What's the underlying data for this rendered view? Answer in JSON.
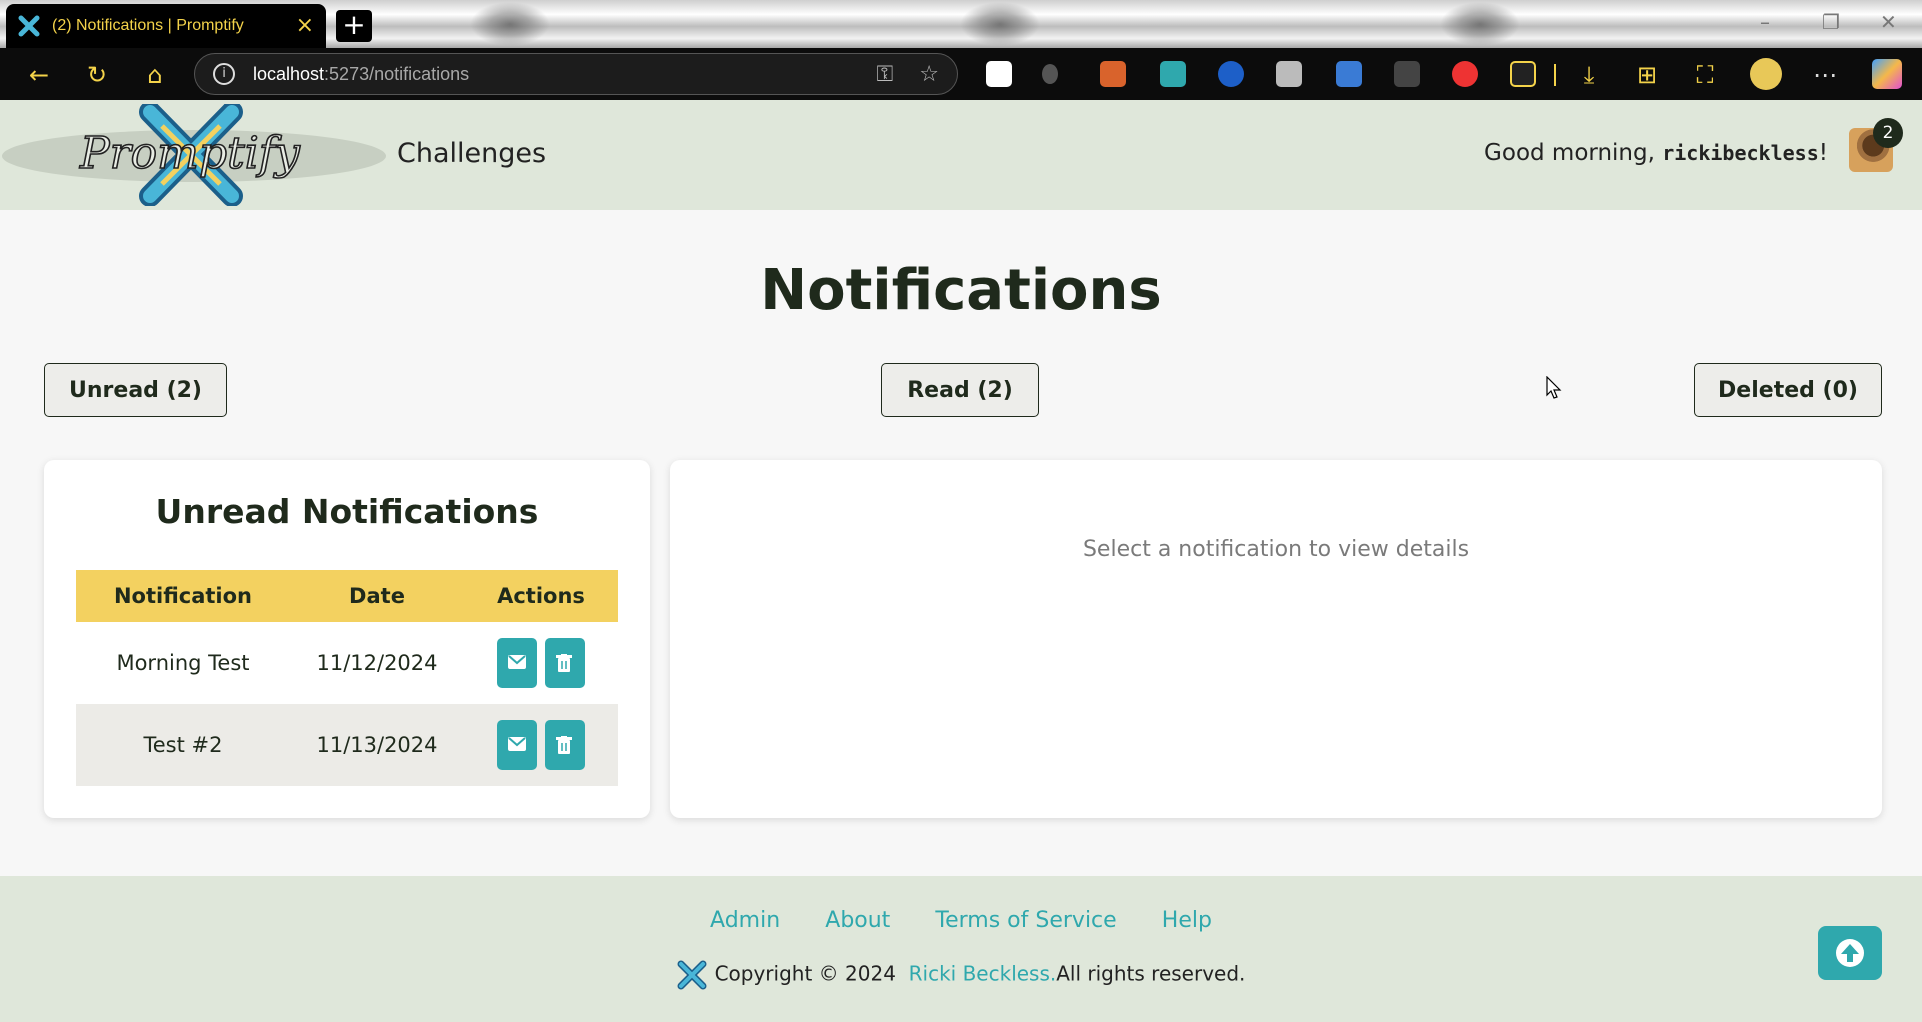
{
  "browser": {
    "tab_title": "(2) Notifications | Promptify",
    "tab_close": "×",
    "new_tab": "+",
    "url_host": "localhost",
    "url_path": ":5273/notifications",
    "icons": [
      "back-icon",
      "refresh-icon",
      "home-icon",
      "info-icon",
      "key-icon",
      "star-icon",
      "extensions",
      "download-icon",
      "collections-icon",
      "more-icon",
      "copilot-icon"
    ]
  },
  "header": {
    "brand": "Promptify",
    "nav_challenges": "Challenges",
    "greeting_prefix": "Good morning, ",
    "username": "rickibeckless",
    "greeting_suffix": "!",
    "notification_count": "2"
  },
  "page": {
    "title": "Notifications",
    "filters": [
      {
        "label": "Unread (2)"
      },
      {
        "label": "Read (2)"
      },
      {
        "label": "Deleted (0)"
      }
    ]
  },
  "list": {
    "title": "Unread Notifications",
    "columns": [
      "Notification",
      "Date",
      "Actions"
    ],
    "rows": [
      {
        "notification": "Morning Test",
        "date": "11/12/2024"
      },
      {
        "notification": "Test #2",
        "date": "11/13/2024"
      }
    ]
  },
  "detail": {
    "placeholder": "Select a notification to view details"
  },
  "footer": {
    "links": [
      "Admin",
      "About",
      "Terms of Service",
      "Help"
    ],
    "copyright_prefix": "Copyright © 2024",
    "author": "Ricki Beckless.",
    "rights": "All rights reserved."
  },
  "colors": {
    "accent_teal": "#2fa8ad",
    "table_header_yellow": "#f3d160",
    "header_bg": "#dfe7da",
    "tab_text_yellow": "#f4d34a"
  }
}
